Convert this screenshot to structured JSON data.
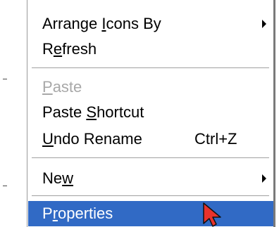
{
  "menu": {
    "groups": [
      [
        {
          "pre": "Arrange ",
          "accel": "I",
          "post": "cons By",
          "shortcut": "",
          "submenu": true,
          "disabled": false,
          "highlighted": false
        },
        {
          "pre": "R",
          "accel": "e",
          "post": "fresh",
          "shortcut": "",
          "submenu": false,
          "disabled": false,
          "highlighted": false
        }
      ],
      [
        {
          "pre": "",
          "accel": "P",
          "post": "aste",
          "shortcut": "",
          "submenu": false,
          "disabled": true,
          "highlighted": false
        },
        {
          "pre": "Paste ",
          "accel": "S",
          "post": "hortcut",
          "shortcut": "",
          "submenu": false,
          "disabled": false,
          "highlighted": false
        },
        {
          "pre": "",
          "accel": "U",
          "post": "ndo Rename",
          "shortcut": "Ctrl+Z",
          "submenu": false,
          "disabled": false,
          "highlighted": false
        }
      ],
      [
        {
          "pre": "Ne",
          "accel": "w",
          "post": "",
          "shortcut": "",
          "submenu": true,
          "disabled": false,
          "highlighted": false
        }
      ],
      [
        {
          "pre": "P",
          "accel": "r",
          "post": "operties",
          "shortcut": "",
          "submenu": false,
          "disabled": false,
          "highlighted": true
        }
      ]
    ]
  },
  "colors": {
    "highlight": "#316ac5",
    "disabled_text": "#a8a8a8",
    "separator": "#a0a0a0"
  },
  "icons": {
    "submenu": "chevron-right-icon",
    "cursor": "mouse-pointer-icon"
  }
}
